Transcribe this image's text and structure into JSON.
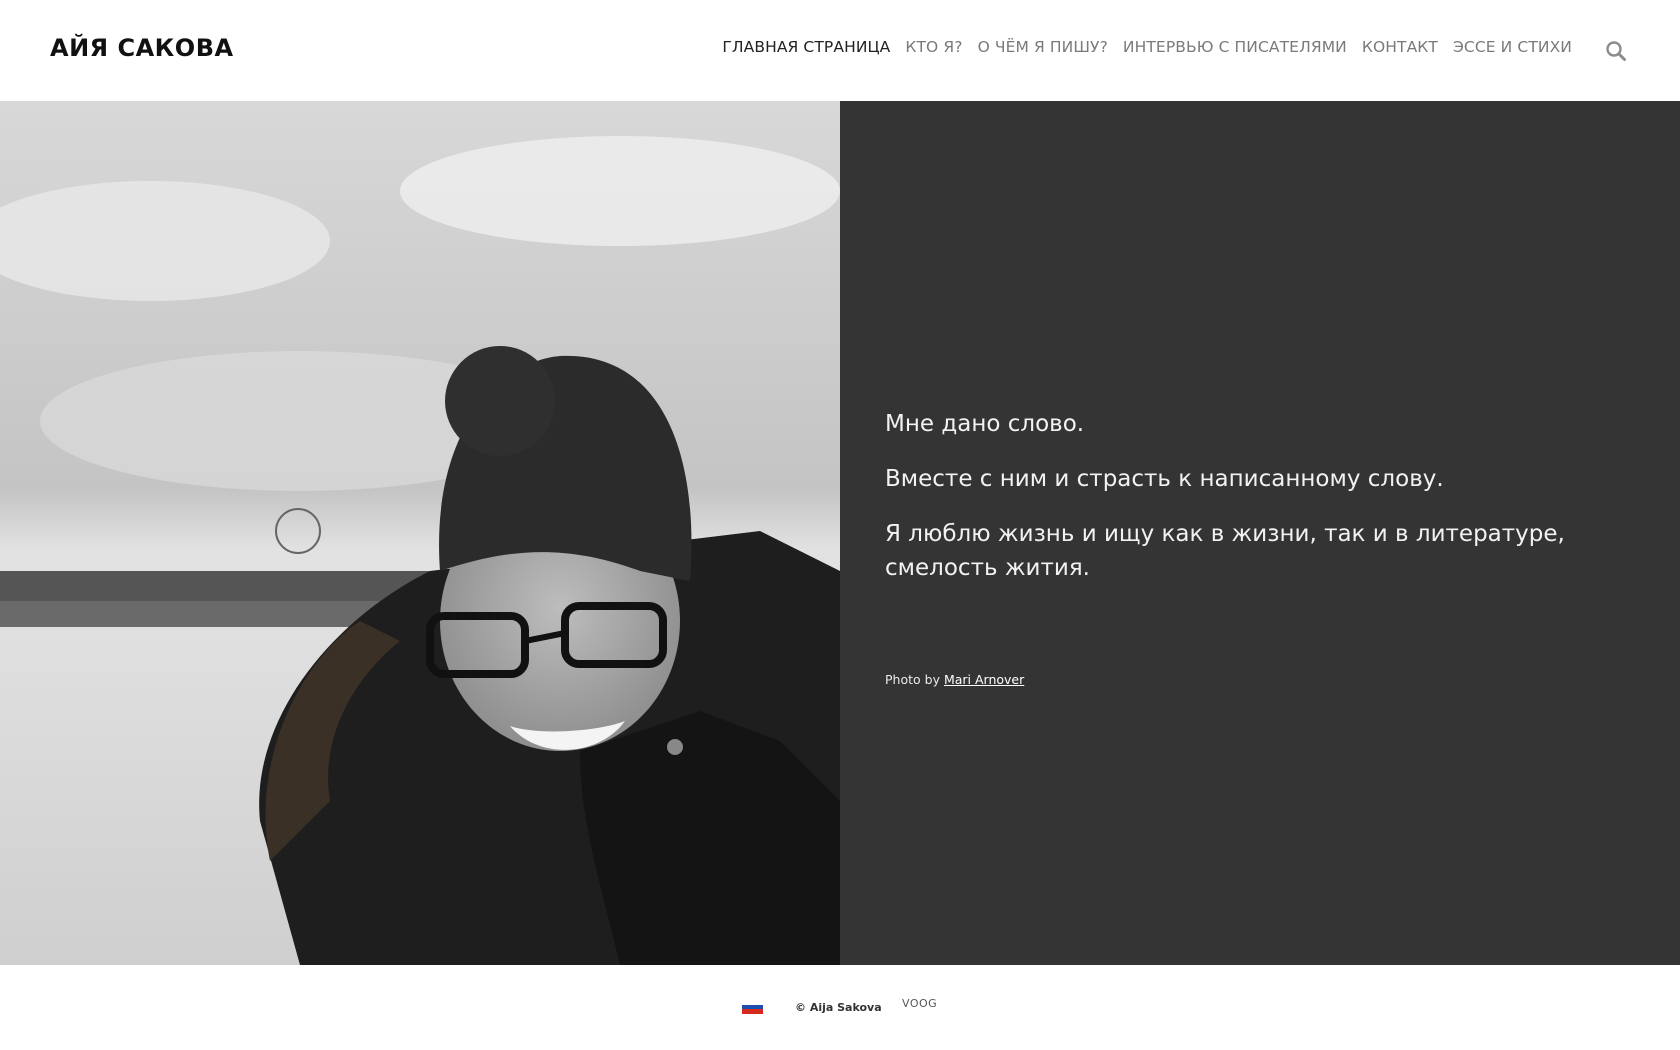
{
  "site": {
    "logo": "АЙЯ САКОВА"
  },
  "nav": {
    "items": [
      {
        "label": "ГЛАВНАЯ СТРАНИЦА",
        "active": true
      },
      {
        "label": "КТО Я?"
      },
      {
        "label": "О ЧЁМ Я ПИШУ?"
      },
      {
        "label": "ИНТЕРВЬЮ С ПИСАТЕЛЯМИ"
      },
      {
        "label": "КОНТАКТ"
      },
      {
        "label": "ЭССЕ И СТИХИ"
      }
    ],
    "search_icon": "search-icon"
  },
  "hero": {
    "photo_alt": "portrait-photo",
    "paragraphs": [
      "Мне дано слово.",
      "Вместе с ним и страсть к написанному слову.",
      "Я люблю жизнь и ищу как в жизни, так и в литературе, смелость жития."
    ],
    "credit_prefix": "Photo by",
    "credit_link": "Mari Arnover"
  },
  "footer": {
    "language_flag": "russian-flag-icon",
    "copyright": "© Aija Sakova",
    "powered_by": "VOOG"
  },
  "colors": {
    "text_panel_bg": "#343434",
    "header_bg": "#ffffff",
    "nav_active": "#222222",
    "nav_inactive": "#7a7a7a"
  }
}
